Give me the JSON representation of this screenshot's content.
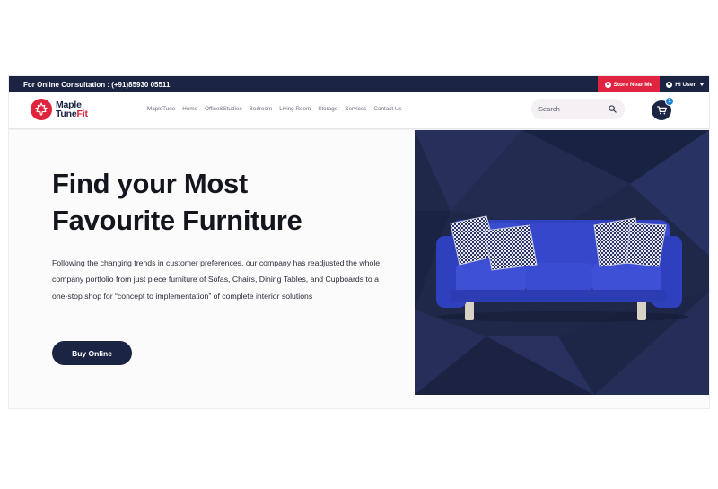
{
  "topbar": {
    "consultation": "For Online Consultation : (+91)85930 05511",
    "store_button": "Store Near Me",
    "user_menu": "Hi User"
  },
  "logo": {
    "line1": "Maple",
    "line2a": "Tune",
    "line2b": "Fit"
  },
  "nav": {
    "items": [
      "MapleTune",
      "Home",
      "Office&Studies",
      "Bedroom",
      "Living Room",
      "Storage",
      "Services",
      "Contact Us"
    ]
  },
  "search": {
    "placeholder": "Search"
  },
  "cart": {
    "count": "1"
  },
  "hero": {
    "title_line1": "Find your Most",
    "title_line2": "Favourite Furniture",
    "description": "Following the changing trends in customer preferences, our company has readjusted the whole company portfolio from just piece furniture of Sofas, Chairs, Dining Tables, and Cupboards to a one-stop shop for “concept to implementation” of complete interior solutions",
    "cta": "Buy Online"
  },
  "colors": {
    "navy": "#1c2444",
    "red": "#e02440",
    "sofa_blue": "#3545c9",
    "badge_blue": "#1c84d8"
  },
  "icons": [
    "map-pin-icon",
    "user-circle-icon",
    "chevron-down-icon",
    "search-icon",
    "cart-icon",
    "maple-leaf-icon"
  ]
}
